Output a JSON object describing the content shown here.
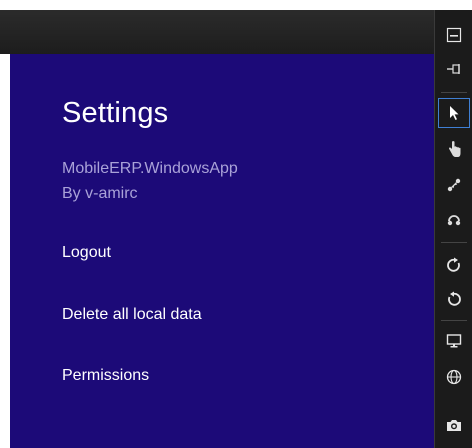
{
  "settings": {
    "title": "Settings",
    "app_name": "MobileERP.WindowsApp",
    "app_author": "By v-amirc",
    "links": {
      "logout": "Logout",
      "delete_local_data": "Delete all local data",
      "permissions": "Permissions"
    }
  },
  "toolbar": {
    "tools": [
      "minimize-icon",
      "pin-icon",
      "pointer-icon",
      "hand-icon",
      "pinch-icon",
      "rotate-gesture-icon",
      "rotate-clockwise-icon",
      "rotate-counterclockwise-icon",
      "monitor-icon",
      "globe-icon",
      "camera-icon"
    ],
    "active_tool": "pointer-icon"
  },
  "colors": {
    "panel_background": "#1c0a78",
    "secondary_text": "#a9a2d8",
    "toolbar_background": "#1b1b1b",
    "active_tool_border": "#3f7fd4"
  }
}
